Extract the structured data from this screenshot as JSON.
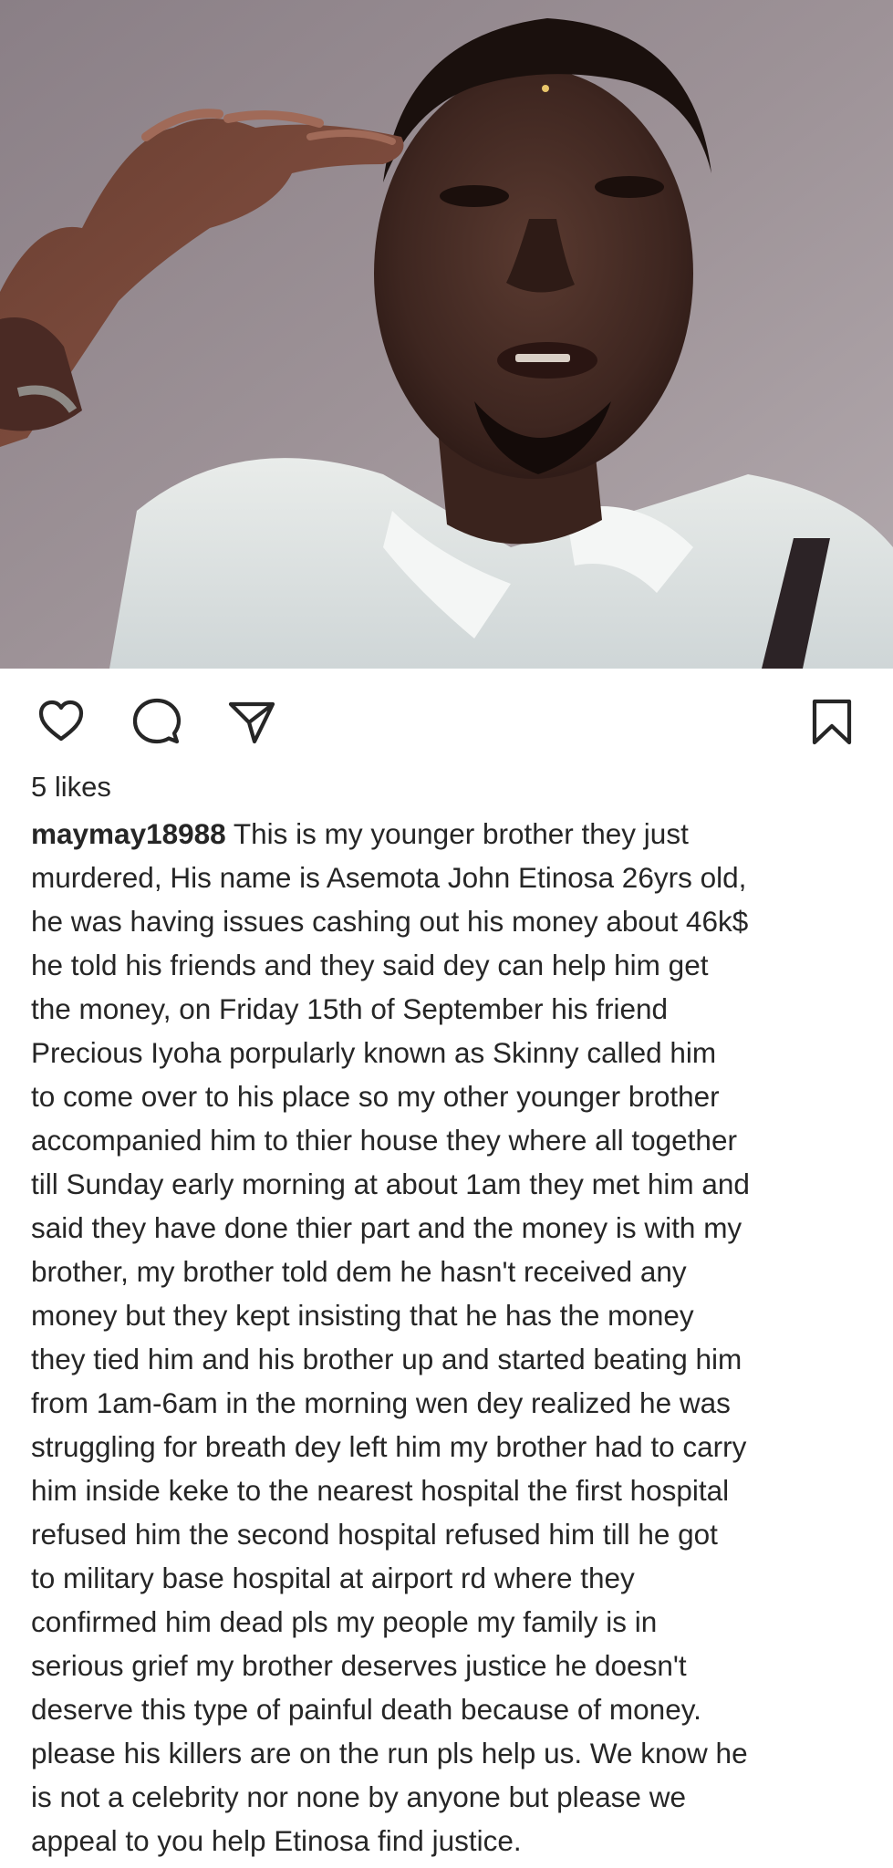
{
  "post": {
    "likes_label": "5 likes",
    "username": "maymay18988",
    "caption_lines": [
      "This is my younger brother they just",
      "murdered, His name is Asemota John Etinosa 26yrs old,",
      "he was having issues cashing out his money about 46k$",
      "he told his friends and they said dey can help him get",
      "the money, on Friday 15th of September his friend",
      "Precious Iyoha porpularly  known as Skinny called him",
      "to come over to his place so my other younger brother",
      "accompanied him to thier house they where all together",
      "till Sunday early morning at about 1am they met him and",
      "said they have done thier part and the money is with my",
      "brother, my brother told dem he hasn't received any",
      "money but they kept insisting that he has the money",
      "they tied him and his brother up and started beating him",
      "from 1am-6am in the morning wen dey realized he was",
      "struggling for breath dey left him my brother had to carry",
      "him inside keke to the nearest hospital the first hospital",
      "refused him the second hospital refused him till he got",
      "to military base hospital at airport rd where they",
      "confirmed him dead pls my people my family is in",
      "serious grief my brother deserves justice he doesn't",
      "deserve this type of painful death because of money.",
      "please his killers are on the run pls help us. We know he",
      "is not a celebrity nor none by anyone but please we",
      "appeal to you help Etinosa find justice."
    ]
  },
  "icons": {
    "like": "heart-icon",
    "comment": "comment-bubble-icon",
    "share": "paper-plane-icon",
    "save": "bookmark-icon"
  },
  "colors": {
    "text": "#262626",
    "icon_stroke": "#262626",
    "background": "#ffffff"
  }
}
